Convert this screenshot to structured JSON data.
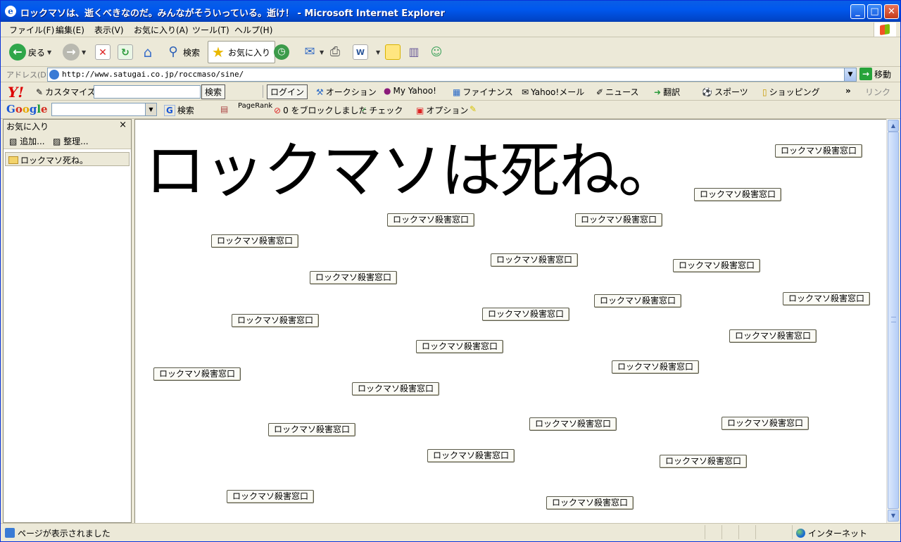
{
  "window": {
    "title": "ロックマソは、逝くべきなのだ。みんながそういっている。逝け！ - Microsoft Internet Explorer",
    "app_icon": "e",
    "minimize": "_",
    "maximize": "□",
    "close": "✕"
  },
  "menu": [
    "ファイル(F)",
    "編集(E)",
    "表示(V)",
    "お気に入り(A)",
    "ツール(T)",
    "ヘルプ(H)"
  ],
  "toolbar": {
    "back_label": "戻る",
    "search_label": "検索",
    "favorites_label": "お気に入り"
  },
  "address": {
    "label": "アドレス(D)",
    "url": "http://www.satugai.co.jp/roccmaso/sine/",
    "go_label": "移動"
  },
  "yahoo_toolbar": {
    "logo": "Y!",
    "customize": "カスタマイズ",
    "search_button": "検索",
    "login_button": "ログイン",
    "items": [
      "オークション",
      "My Yahoo!",
      "ファイナンス",
      "Yahoo!メール",
      "ニュース",
      "翻訳",
      "スポーツ",
      "ショッピング"
    ],
    "more": "»",
    "links": "リンク"
  },
  "google_toolbar": {
    "logo": "Google",
    "search_button": "検索",
    "pagerank": "PageRank",
    "popup_blocked": "0 をブロックしました",
    "check": "チェック",
    "options": "オプション"
  },
  "favorites_panel": {
    "title": "お気に入り",
    "close": "×",
    "add_label": "追加...",
    "organize_label": "整理...",
    "items": [
      "ロックマソ死ね。"
    ]
  },
  "page": {
    "heading": "ロックマソは死ね。",
    "button_label": "ロックマソ殺害窓口",
    "button_count": 28
  },
  "status": {
    "text": "ページが表示されました",
    "zone": "インターネット"
  },
  "colors": {
    "titlebar": "#0058ee",
    "chrome": "#ece9d8",
    "content_bg": "#ffffff"
  }
}
